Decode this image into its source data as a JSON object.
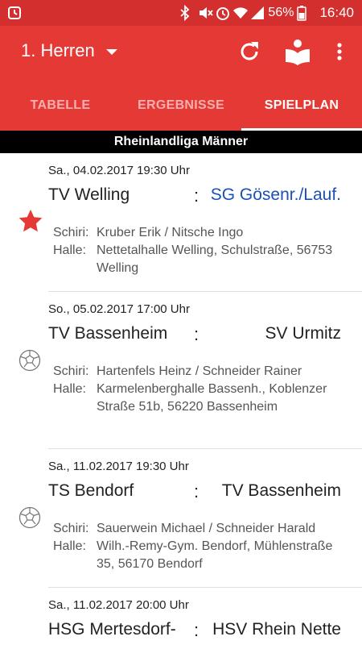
{
  "status_bar": {
    "battery": "56%",
    "time": "16:40",
    "icons": [
      "alarm-icon",
      "bluetooth-icon",
      "mute-icon",
      "alarm-clock-icon",
      "wifi-icon",
      "signal-icon",
      "battery-icon"
    ]
  },
  "app_bar": {
    "team": "1. Herren",
    "actions": [
      "refresh-icon",
      "rules-book-icon",
      "more-vert-icon"
    ]
  },
  "tabs": [
    {
      "label": "TABELLE",
      "active": false
    },
    {
      "label": "ERGEBNISSE",
      "active": false
    },
    {
      "label": "SPIELPLAN",
      "active": true
    }
  ],
  "league": "Rheinlandliga Männer",
  "matches": [
    {
      "date": "Sa., 04.02.2017 19:30 Uhr",
      "home": "TV Welling",
      "separator": ":",
      "away": "SG Gösenr./Lauf.",
      "status_icon": "star-icon",
      "referee_label": "Schiri:",
      "referee": "Kruber Erik / Nitsche Ingo",
      "hall_label": "Halle:",
      "hall": "Nettetalhalle Welling, Schulstraße, 56753 Welling"
    },
    {
      "date": "So., 05.02.2017 17:00 Uhr",
      "home": "TV Bassenheim",
      "separator": ":",
      "away": "SV Urmitz",
      "status_icon": "handball-icon",
      "referee_label": "Schiri:",
      "referee": "Hartenfels Heinz / Schneider Rainer",
      "hall_label": "Halle:",
      "hall": "Karmelenberghalle Bassenh., Koblenzer Straße 51b, 56220 Bassenheim"
    },
    {
      "date": "Sa., 11.02.2017 19:30 Uhr",
      "home": "TS Bendorf",
      "separator": ":",
      "away": "TV Bassenheim",
      "status_icon": "handball-icon",
      "referee_label": "Schiri:",
      "referee": "Sauerwein Michael / Schneider Harald",
      "hall_label": "Halle:",
      "hall": "Wilh.-Remy-Gym. Bendorf, Mühlenstraße 35, 56170 Bendorf"
    },
    {
      "date": "Sa., 11.02.2017 20:00 Uhr",
      "home": "HSG Mertesdorf-",
      "separator": ":",
      "away": "HSV Rhein Nette"
    }
  ],
  "colors": {
    "status_bar": "#d32f2f",
    "app_bar": "#e53935",
    "league_banner": "#000000",
    "link": "#1a50b8",
    "star": "#e53935"
  }
}
